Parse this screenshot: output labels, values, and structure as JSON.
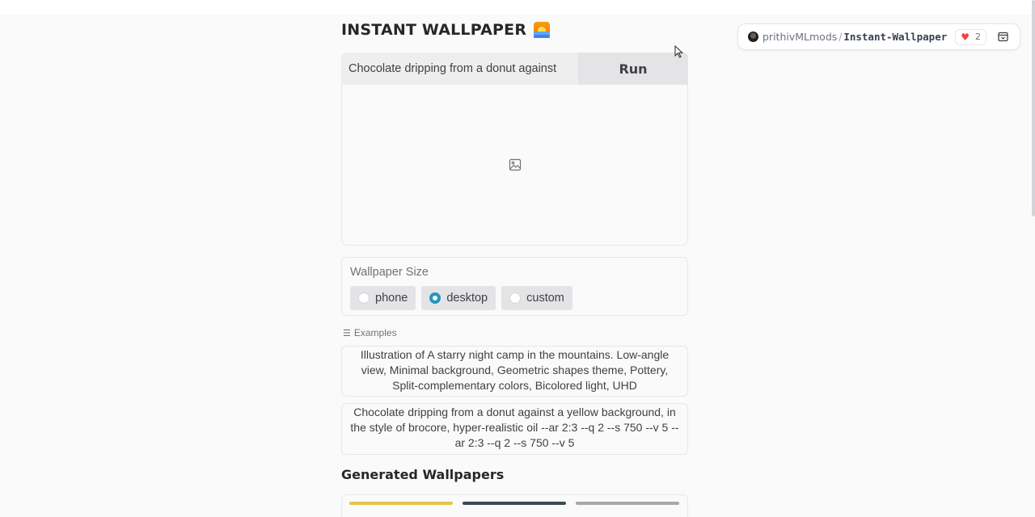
{
  "space": {
    "owner": "prithivMLmods",
    "separator": "/",
    "name": "Instant-Wallpaper",
    "likes": "2"
  },
  "app": {
    "title": "INSTANT WALLPAPER",
    "prompt_value": "Chocolate dripping from a donut against",
    "run_label": "Run"
  },
  "size_panel": {
    "label": "Wallpaper Size",
    "options": [
      {
        "label": "phone",
        "checked": false
      },
      {
        "label": "desktop",
        "checked": true
      },
      {
        "label": "custom",
        "checked": false
      }
    ]
  },
  "examples": {
    "label": "Examples",
    "items": [
      "Illustration of A starry night camp in the mountains. Low-angle view, Minimal background, Geometric shapes theme, Pottery, Split-complementary colors, Bicolored light, UHD",
      "Chocolate dripping from a donut against a yellow background, in the style of brocore, hyper-realistic oil --ar 2:3 --q 2 --s 750 --v 5 --ar 2:3 --q 2 --s 750 --v 5"
    ]
  },
  "gallery": {
    "title": "Generated Wallpapers"
  },
  "colors": {
    "accent_radio": "#2596be",
    "heart": "#ef4444",
    "background": "#fafafa"
  },
  "icons": {
    "title": "sunrise-emoji-icon",
    "image_placeholder": "image-icon",
    "examples": "list-icon",
    "like": "heart-icon",
    "embed": "embed-icon"
  }
}
